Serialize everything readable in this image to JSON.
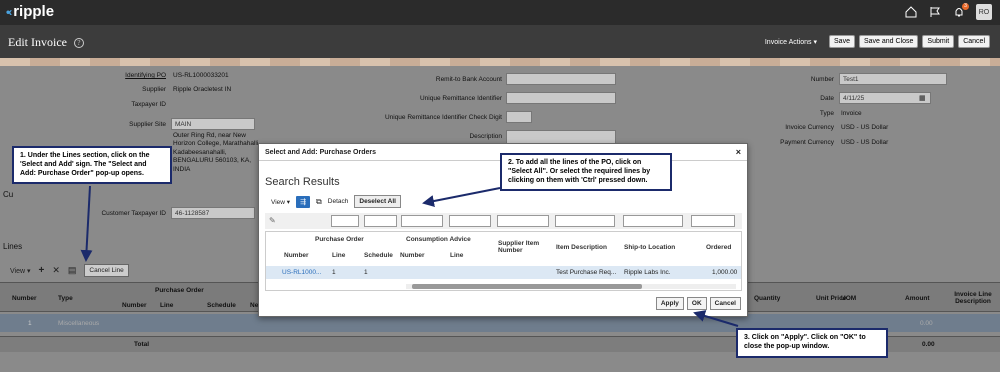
{
  "app": {
    "logo_text": "ripple",
    "avatar": "RO",
    "notification_count": "3"
  },
  "page": {
    "title": "Edit Invoice"
  },
  "actions": {
    "invoice_actions": "Invoice Actions ▾",
    "save": "Save",
    "save_close": "Save and Close",
    "submit": "Submit",
    "cancel": "Cancel"
  },
  "form": {
    "identifying_po_label": "Identifying PO",
    "identifying_po": "US-RL1000033201",
    "supplier_label": "Supplier",
    "supplier": "Ripple Oracletest IN",
    "taxpayer_id_label": "Taxpayer ID",
    "supplier_site_label": "Supplier Site",
    "supplier_site": "MAIN",
    "address": "Outer Ring Rd, near New Horizon College, Marathahalli, Kadabeesanahalli, BENGALURU 560103, KA, INDIA",
    "remit_label": "Remit-to Bank Account",
    "unique_remit_label": "Unique Remittance Identifier",
    "unique_remit_check_label": "Unique Remittance Identifier Check Digit",
    "description_label": "Description",
    "number_label": "Number",
    "number": "Test1",
    "date_label": "Date",
    "date": "4/11/25",
    "type_label": "Type",
    "type": "Invoice",
    "invoice_currency_label": "Invoice Currency",
    "invoice_currency": "USD - US Dollar",
    "payment_currency_label": "Payment Currency",
    "payment_currency": "USD - US Dollar",
    "customer_taxpayer_label": "Customer Taxpayer ID",
    "customer_taxpayer": "46-1128587",
    "partial_label": "Cu"
  },
  "lines": {
    "title": "Lines",
    "view": "View ▾",
    "cancel_line": "Cancel Line",
    "headers": {
      "number": "Number",
      "type": "Type",
      "purchase_order": "Purchase Order",
      "po_number": "Number",
      "po_line": "Line",
      "po_schedule": "Schedule",
      "ne": "Ne",
      "quantity": "Quantity",
      "unit_price": "Unit Price",
      "uom": "UOM",
      "amount": "Amount",
      "desc": "Invoice Line Description"
    },
    "row": {
      "number": "1",
      "type": "Miscellaneous",
      "amount": "0.00"
    },
    "total_label": "Total",
    "total": "0.00"
  },
  "dialog": {
    "title": "Select and Add: Purchase Orders",
    "search_results": "Search Results",
    "view": "View ▾",
    "detach": "Detach",
    "deselect_all": "Deselect All",
    "headers": {
      "purchase_order": "Purchase Order",
      "consumption_advice": "Consumption Advice",
      "number": "Number",
      "line": "Line",
      "schedule": "Schedule",
      "ca_number": "Number",
      "ca_line": "Line",
      "supplier_item": "Supplier Item Number",
      "item_desc": "Item Description",
      "ship_to": "Ship-to Location",
      "ordered": "Ordered"
    },
    "row": {
      "number": "US-RL1000...",
      "line": "1",
      "schedule": "1",
      "item_desc": "Test Purchase Req...",
      "ship_to": "Ripple Labs Inc.",
      "ordered": "1,000.00"
    },
    "apply": "Apply",
    "ok": "OK",
    "cancel": "Cancel"
  },
  "annotations": {
    "a1": "1. Under the Lines section, click on the 'Select and Add' sign. The \"Select and Add: Purchase Order\" pop-up opens.",
    "a2": "2. To add all the lines of the PO, click on \"Select All\". Or select the required lines by clicking on them with 'Ctrl' pressed down.",
    "a3": "3. Click on \"Apply\". Click on \"OK\" to close the pop-up window."
  }
}
